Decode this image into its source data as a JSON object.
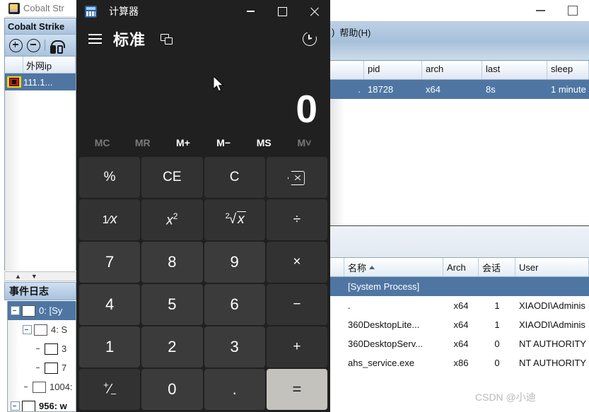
{
  "left_window": {
    "title": "Cobalt Str",
    "icon": "cobalt-strike-icon",
    "panel_title": "Cobalt Strike",
    "toolbar": [
      {
        "name": "zoom-in-icon",
        "label": "+"
      },
      {
        "name": "zoom-out-icon",
        "label": "−"
      },
      {
        "name": "headphones-icon",
        "label": ""
      }
    ],
    "table": {
      "headers": [
        "",
        "外网ip"
      ],
      "rows": [
        {
          "icon": "beacon-icon",
          "ip": "111.1..."
        }
      ]
    },
    "splitter": {
      "up": "▲",
      "down": "▼"
    },
    "tab_label": "事件日志",
    "tree": [
      {
        "indent": 0,
        "expander": "minus",
        "label": "0: [Sy",
        "selected": true,
        "bold": false
      },
      {
        "indent": 1,
        "expander": "minus",
        "label": "4: S",
        "selected": false,
        "bold": false
      },
      {
        "indent": 2,
        "expander": "none",
        "label": "3",
        "selected": false,
        "bold": false
      },
      {
        "indent": 2,
        "expander": "none",
        "label": "7",
        "selected": false,
        "bold": false
      },
      {
        "indent": 1,
        "expander": "none",
        "label": "1004:",
        "selected": false,
        "bold": false
      },
      {
        "indent": 0,
        "expander": "minus",
        "label": "956: w",
        "selected": false,
        "bold": true
      }
    ]
  },
  "right_window": {
    "window_buttons": [
      "minimize",
      "maximize"
    ],
    "menu_trailing": ")",
    "menu_item": "帮助(H)",
    "beacon_table": {
      "headers": [
        "pid",
        "arch",
        "last",
        "sleep"
      ],
      "rows": [
        {
          "pre": ".",
          "pid": "18728",
          "arch": "x64",
          "last": "8s",
          "sleep": "1 minute"
        }
      ]
    },
    "process_table": {
      "headers": [
        "名称",
        "Arch",
        "会话",
        "User"
      ],
      "sorted_column": "名称",
      "rows": [
        {
          "name": "[System Process]",
          "arch": "",
          "session": "",
          "user": "",
          "selected": true
        },
        {
          "name": ".",
          "arch": "x64",
          "session": "1",
          "user": "XIAODI\\Adminis",
          "selected": false
        },
        {
          "name": "360DesktopLite...",
          "arch": "x64",
          "session": "1",
          "user": "XIAODI\\Adminis",
          "selected": false
        },
        {
          "name": "360DesktopServ...",
          "arch": "x64",
          "session": "0",
          "user": "NT AUTHORITY",
          "selected": false
        },
        {
          "name": "ahs_service.exe",
          "arch": "x86",
          "session": "0",
          "user": "NT AUTHORITY",
          "selected": false
        }
      ]
    }
  },
  "watermark": "CSDN @小迪",
  "calculator": {
    "title": "计算器",
    "icon": "calculator-icon",
    "window_buttons": {
      "minimize": "minimize-icon",
      "maximize": "maximize-icon",
      "close": "close-icon"
    },
    "menu_icon": "hamburger-icon",
    "mode": "标准",
    "keep_on_top_icon": "keep-on-top-icon",
    "history_icon": "history-icon",
    "display": "0",
    "memory_buttons": [
      {
        "label": "MC",
        "enabled": false
      },
      {
        "label": "MR",
        "enabled": false
      },
      {
        "label": "M+",
        "enabled": true
      },
      {
        "label": "M−",
        "enabled": true
      },
      {
        "label": "MS",
        "enabled": true
      },
      {
        "label": "M˅",
        "enabled": false
      }
    ],
    "keys": [
      {
        "label": "%",
        "name": "percent-button",
        "type": "fn"
      },
      {
        "label": "CE",
        "name": "clear-entry-button",
        "type": "fn"
      },
      {
        "label": "C",
        "name": "clear-button",
        "type": "fn"
      },
      {
        "label": "",
        "name": "backspace-button",
        "type": "backspace"
      },
      {
        "label": "",
        "name": "reciprocal-button",
        "type": "reciprocal"
      },
      {
        "label": "",
        "name": "square-button",
        "type": "square"
      },
      {
        "label": "",
        "name": "square-root-button",
        "type": "sqrt"
      },
      {
        "label": "÷",
        "name": "divide-button",
        "type": "fn"
      },
      {
        "label": "7",
        "name": "digit-7-button",
        "type": "num"
      },
      {
        "label": "8",
        "name": "digit-8-button",
        "type": "num"
      },
      {
        "label": "9",
        "name": "digit-9-button",
        "type": "num"
      },
      {
        "label": "×",
        "name": "multiply-button",
        "type": "fn"
      },
      {
        "label": "4",
        "name": "digit-4-button",
        "type": "num"
      },
      {
        "label": "5",
        "name": "digit-5-button",
        "type": "num"
      },
      {
        "label": "6",
        "name": "digit-6-button",
        "type": "num"
      },
      {
        "label": "−",
        "name": "subtract-button",
        "type": "fn"
      },
      {
        "label": "1",
        "name": "digit-1-button",
        "type": "num"
      },
      {
        "label": "2",
        "name": "digit-2-button",
        "type": "num"
      },
      {
        "label": "3",
        "name": "digit-3-button",
        "type": "num"
      },
      {
        "label": "+",
        "name": "add-button",
        "type": "fn"
      },
      {
        "label": "",
        "name": "sign-toggle-button",
        "type": "plusminus"
      },
      {
        "label": "0",
        "name": "digit-0-button",
        "type": "num"
      },
      {
        "label": ".",
        "name": "decimal-button",
        "type": "num"
      },
      {
        "label": "=",
        "name": "equals-button",
        "type": "eq"
      }
    ]
  },
  "colors": {
    "calc_background": "#202020",
    "calc_function_key": "#323232",
    "calc_digit_key": "#3b3b3b",
    "calc_equals_key": "#c3c2bd",
    "selection_blue": "#4f76a3",
    "titlebar_blue": "#a7c0da"
  }
}
